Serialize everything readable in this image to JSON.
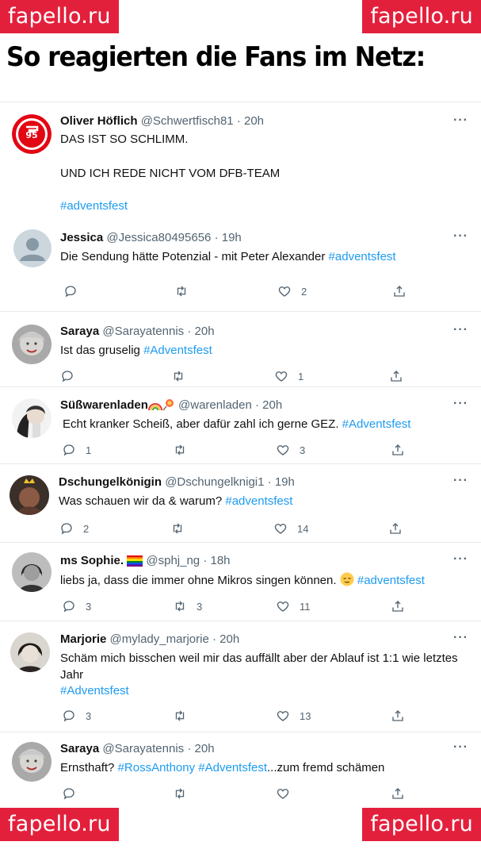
{
  "watermark": {
    "text": "fapello.ru",
    "color": "#e3203c"
  },
  "headline": "So reagierten die Fans im Netz:",
  "colors": {
    "hashtag": "#1d9bf0",
    "secondary": "#536471",
    "divider": "#e6e9ec"
  },
  "tweets": [
    {
      "author": "Oliver Höflich",
      "handle": "@Schwertfisch81",
      "time": "· 20h",
      "lines": [
        "DAS IST SO SCHLIMM.",
        "UND ICH REDE NICHT VOM DFB-TEAM"
      ],
      "hashtag": "#adventsfest",
      "avatar": "club-logo-icon",
      "more": "···"
    },
    {
      "author": "Jessica",
      "handle": "@Jessica80495656",
      "time": "· 19h",
      "text": "Die Sendung hätte Potenzial - mit Peter Alexander ",
      "hashtag": "#adventsfest",
      "avatar": "default-avatar-icon",
      "more": "···",
      "counts": {
        "reply": "",
        "retweet": "",
        "like": "2"
      }
    },
    {
      "author": "Saraya",
      "handle": "@Sarayatennis",
      "time": "· 20h",
      "text": "Ist das gruselig ",
      "hashtag": "#Adventsfest",
      "avatar": "photo-avatar",
      "more": "···",
      "counts": {
        "reply": "",
        "retweet": "",
        "like": "1"
      }
    },
    {
      "author": "Süßwarenladen",
      "handle": "@warenladen",
      "time": "· 20h",
      "text": "Echt kranker Scheiß, aber dafür zahl ich gerne GEZ. ",
      "hashtag": "#Adventsfest",
      "avatar": "photo-avatar",
      "more": "···",
      "name_emoji": [
        "rainbow-icon",
        "lollipop-icon"
      ],
      "counts": {
        "reply": "1",
        "retweet": "",
        "like": "3"
      }
    },
    {
      "author": "Dschungelkönigin",
      "handle": "@Dschungelknigi1",
      "time": "· 19h",
      "text": "Was schauen wir da & warum? ",
      "hashtag": "#adventsfest",
      "avatar": "photo-avatar",
      "more": "···",
      "counts": {
        "reply": "2",
        "retweet": "",
        "like": "14"
      }
    },
    {
      "author": "ms Sophie.",
      "handle": "@sphj_ng",
      "time": "· 18h",
      "text": "liebs ja, dass die immer ohne Mikros singen können. ",
      "hashtag": "#adventsfest",
      "avatar": "photo-avatar",
      "more": "···",
      "name_emoji": [
        "rainbow-flag-icon"
      ],
      "text_emoji": "relieved-face-icon",
      "counts": {
        "reply": "3",
        "retweet": "3",
        "like": "11"
      }
    },
    {
      "author": "Marjorie",
      "handle": "@mylady_marjorie",
      "time": "· 20h",
      "lines": [
        "Schäm mich bisschen weil mir das auffällt aber der Ablauf ist 1:1 wie letztes",
        "Jahr"
      ],
      "hashtag": "#Adventsfest",
      "avatar": "photo-avatar",
      "more": "···",
      "counts": {
        "reply": "3",
        "retweet": "",
        "like": "13"
      }
    },
    {
      "author": "Saraya",
      "handle": "@Sarayatennis",
      "time": "· 20h",
      "text_pre": "Ernsthaft? ",
      "hashtag": "#RossAnthony",
      "hashtag2": "#Adventsfest",
      "text_post": "...zum fremd schämen",
      "avatar": "photo-avatar",
      "more": "···",
      "counts": {
        "reply": "",
        "retweet": "",
        "like": ""
      }
    }
  ]
}
